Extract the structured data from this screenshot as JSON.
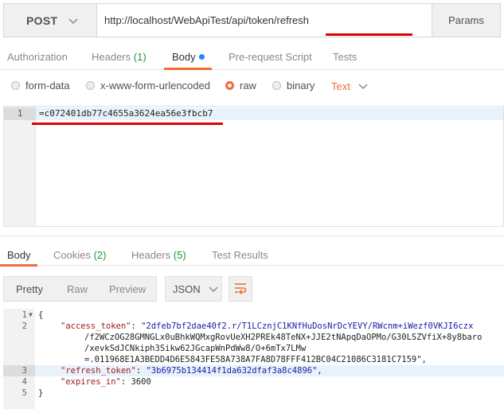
{
  "request": {
    "method": "POST",
    "url": "http://localhost/WebApiTest/api/token/refresh",
    "params_label": "Params"
  },
  "request_tabs": {
    "authorization": "Authorization",
    "headers": "Headers",
    "headers_count": "(1)",
    "body": "Body",
    "pre_request": "Pre-request Script",
    "tests": "Tests"
  },
  "body_types": {
    "form_data": "form-data",
    "urlencoded": "x-www-form-urlencoded",
    "raw": "raw",
    "binary": "binary",
    "text_select": "Text",
    "selected": "raw"
  },
  "editor": {
    "line_number": "1",
    "content": "=c072401db77c4655a3624ea56e3fbcb7"
  },
  "response_tabs": {
    "body": "Body",
    "cookies": "Cookies",
    "cookies_count": "(2)",
    "headers": "Headers",
    "headers_count": "(5)",
    "test_results": "Test Results"
  },
  "response_toolbar": {
    "pretty": "Pretty",
    "raw": "Raw",
    "preview": "Preview",
    "format": "JSON"
  },
  "response_body": {
    "lines": [
      {
        "num": "1",
        "text": "{"
      },
      {
        "num": "2",
        "key": "\"access_token\"",
        "value": "\"2dfeb7bf2dae40f2.r/T1LCznjC1KNfHuDosNrDcYEVY/RWcnm+iWezf0VKJI6czx"
      },
      {
        "num": "",
        "value": "/f2WCzOG28GMNGLx0uBhkWQMxgRovUeXH2PREk48TeNX+JJE2tNApqDaOPMo/G30LSZVfiX+8y8baro"
      },
      {
        "num": "",
        "value": "/xevkSdJCNkiph3Sikw62JGcapWnPdWw8/O+6mTx7LMw"
      },
      {
        "num": "",
        "value": "=.011968E1A3BEDD4D6E5843FE58A738A7FA8D78FFF412BC04C21086C3181C7159\","
      },
      {
        "num": "3",
        "key": "\"refresh_token\"",
        "value": "\"3b6975b134414f1da632dfaf3a8c4896\","
      },
      {
        "num": "4",
        "key": "\"expires_in\"",
        "value": "3600"
      },
      {
        "num": "5",
        "text": "}"
      }
    ]
  },
  "colors": {
    "accent": "#f26b3a",
    "annotation_red": "#e00000",
    "count_green": "#1a9a35",
    "dot_blue": "#2a84ff"
  }
}
